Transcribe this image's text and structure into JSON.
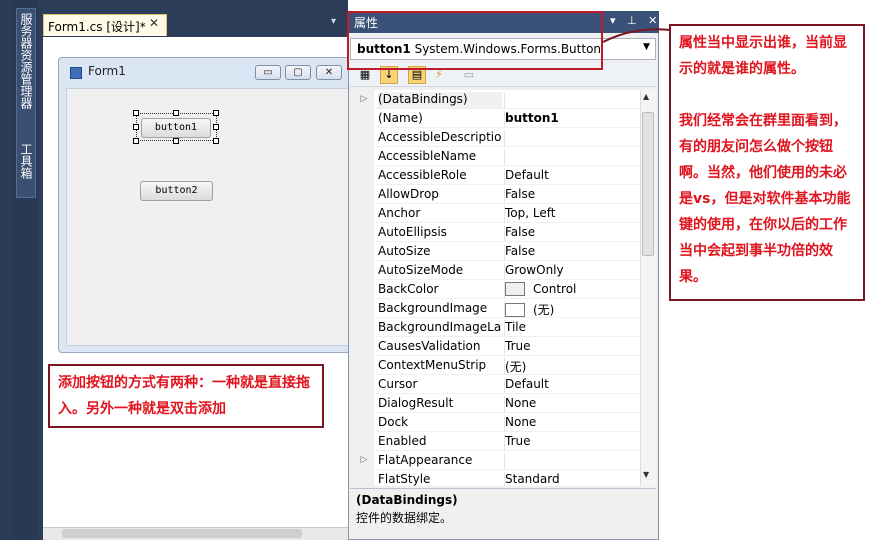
{
  "left_vertical_tabs": {
    "server_explorer": "服务器资源管理器",
    "toolbox": "工具箱"
  },
  "designer": {
    "doc_tab": "Form1.cs [设计]*",
    "close_glyph": "✕",
    "dropdown_glyph": "▾",
    "form_title": "Form1",
    "caption_buttons": [
      "▭",
      "▢",
      "✕"
    ],
    "button1_label": "button1",
    "button2_label": "button2"
  },
  "properties": {
    "panel_title": "属性",
    "header_buttons": "▾ ⊥ ✕",
    "object_name": "button1",
    "object_type": "System.Windows.Forms.Button",
    "rows": [
      {
        "name": "(DataBindings)",
        "value": "",
        "expander": "▷"
      },
      {
        "name": "(Name)",
        "value": "button1",
        "bold": true
      },
      {
        "name": "AccessibleDescription",
        "value": ""
      },
      {
        "name": "AccessibleName",
        "value": ""
      },
      {
        "name": "AccessibleRole",
        "value": "Default"
      },
      {
        "name": "AllowDrop",
        "value": "False"
      },
      {
        "name": "Anchor",
        "value": "Top, Left"
      },
      {
        "name": "AutoEllipsis",
        "value": "False"
      },
      {
        "name": "AutoSize",
        "value": "False"
      },
      {
        "name": "AutoSizeMode",
        "value": "GrowOnly"
      },
      {
        "name": "BackColor",
        "value": "Control",
        "swatch": "#f0f0f0"
      },
      {
        "name": "BackgroundImage",
        "value": "(无)",
        "swatch": "#ffffff"
      },
      {
        "name": "BackgroundImageLayout",
        "value": "Tile"
      },
      {
        "name": "CausesValidation",
        "value": "True"
      },
      {
        "name": "ContextMenuStrip",
        "value": "(无)"
      },
      {
        "name": "Cursor",
        "value": "Default"
      },
      {
        "name": "DialogResult",
        "value": "None"
      },
      {
        "name": "Dock",
        "value": "None"
      },
      {
        "name": "Enabled",
        "value": "True"
      },
      {
        "name": "FlatAppearance",
        "value": "",
        "expander": "▷"
      },
      {
        "name": "FlatStyle",
        "value": "Standard"
      }
    ],
    "description_title": "(DataBindings)",
    "description_text": "控件的数据绑定。"
  },
  "annotations": {
    "right_note_1": "属性当中显示出谁，当前显示的就是谁的属性。",
    "right_note_2": "我们经常会在群里面看到，有的朋友问怎么做个按钮啊。当然，他们使用的未必是vs，但是对软件基本功能键的使用，在你以后的工作当中会起到事半功倍的效果。",
    "bottom_note": "添加按钮的方式有两种：一种就是直接拖入。另外一种就是双击添加"
  },
  "colors": {
    "annotation_text": "#e0141e",
    "annotation_border": "#7a1522",
    "highlight_box": "#c0192a",
    "ide_dark": "#2c3d5a"
  }
}
